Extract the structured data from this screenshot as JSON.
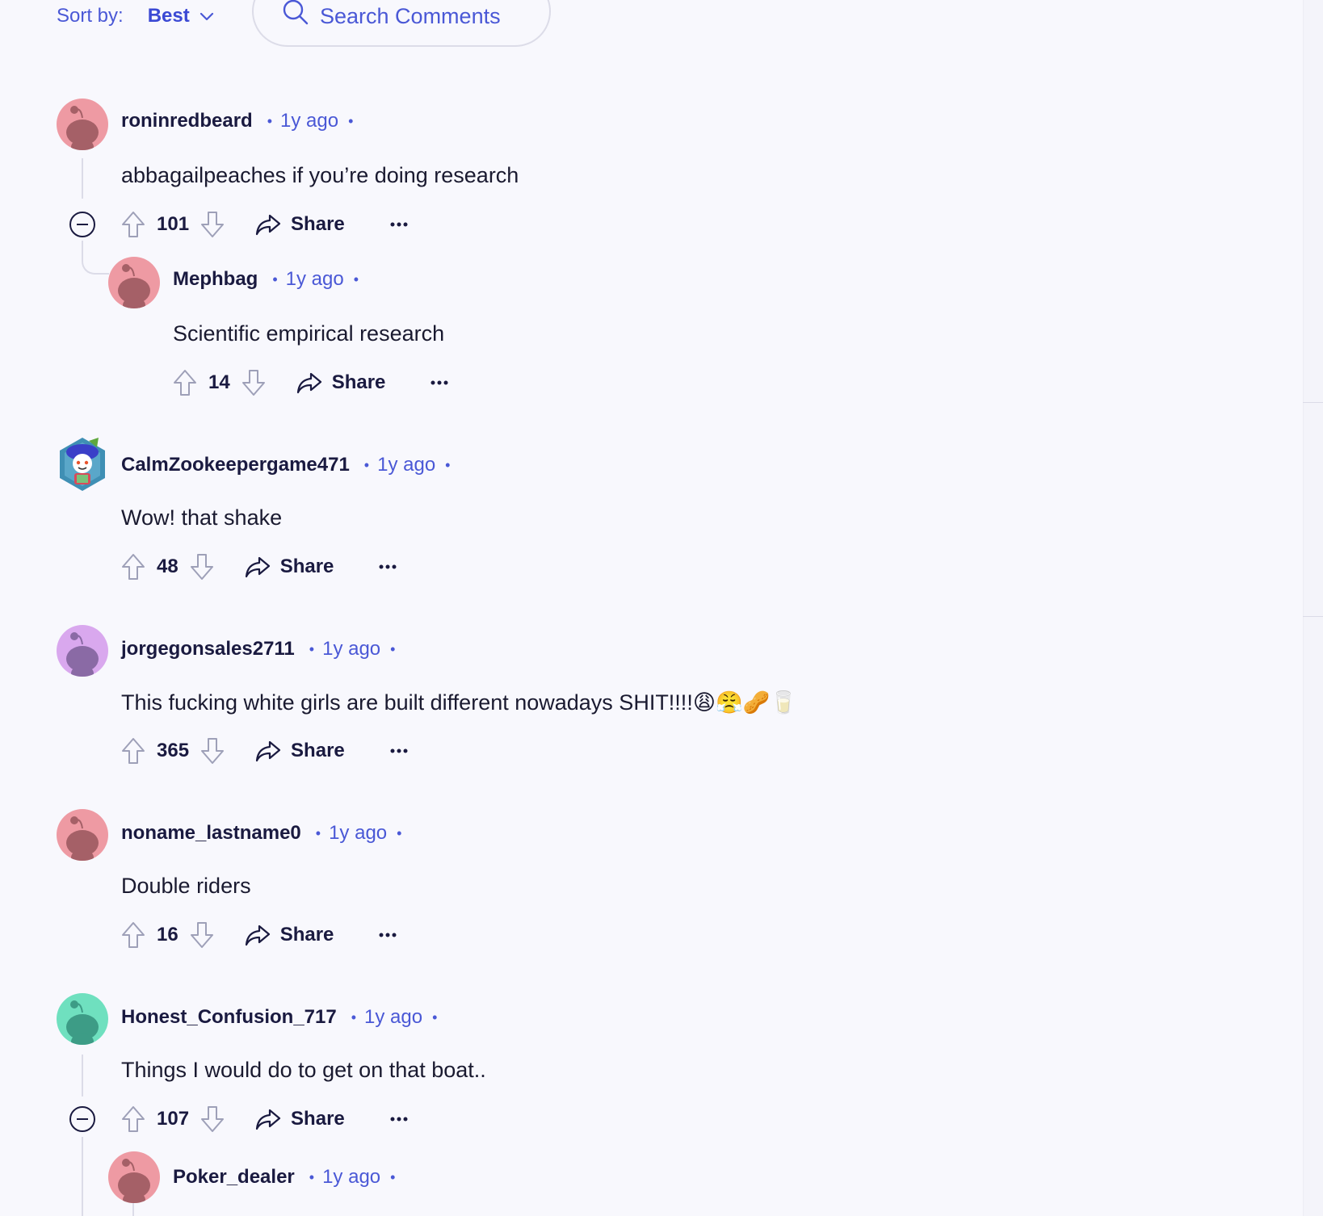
{
  "sort": {
    "label": "Sort by:",
    "value": "Best"
  },
  "search": {
    "placeholder": "Search Comments"
  },
  "share_label": "Share",
  "colors": {
    "accent": "#4a58d6",
    "text": "#1a1a40",
    "avatar_pink": "#ee9aa3",
    "avatar_lilac": "#d9a8ee",
    "avatar_mint": "#6fe0bf"
  },
  "comments": [
    {
      "author": "roninredbeard",
      "time": "1y ago",
      "body": "abbagailpeaches if you’re doing research",
      "score": "101",
      "avatar": "snoo-pink"
    },
    {
      "author": "Mephbag",
      "time": "1y ago",
      "body": "Scientific empirical research",
      "score": "14",
      "avatar": "snoo-pink"
    },
    {
      "author": "CalmZookeepergame471",
      "time": "1y ago",
      "body": "Wow! that shake",
      "score": "48",
      "avatar": "custom-snoo"
    },
    {
      "author": "jorgegonsales2711",
      "time": "1y ago",
      "body": "This fucking white girls are built different nowadays SHIT!!!!😩😤🥜🥛",
      "score": "365",
      "avatar": "snoo-lilac"
    },
    {
      "author": "noname_lastname0",
      "time": "1y ago",
      "body": "Double riders",
      "score": "16",
      "avatar": "snoo-pink"
    },
    {
      "author": "Honest_Confusion_717",
      "time": "1y ago",
      "body": "Things I would do to get on that boat..",
      "score": "107",
      "avatar": "snoo-mint"
    },
    {
      "author": "Poker_dealer",
      "time": "1y ago",
      "avatar": "snoo-pink"
    }
  ]
}
